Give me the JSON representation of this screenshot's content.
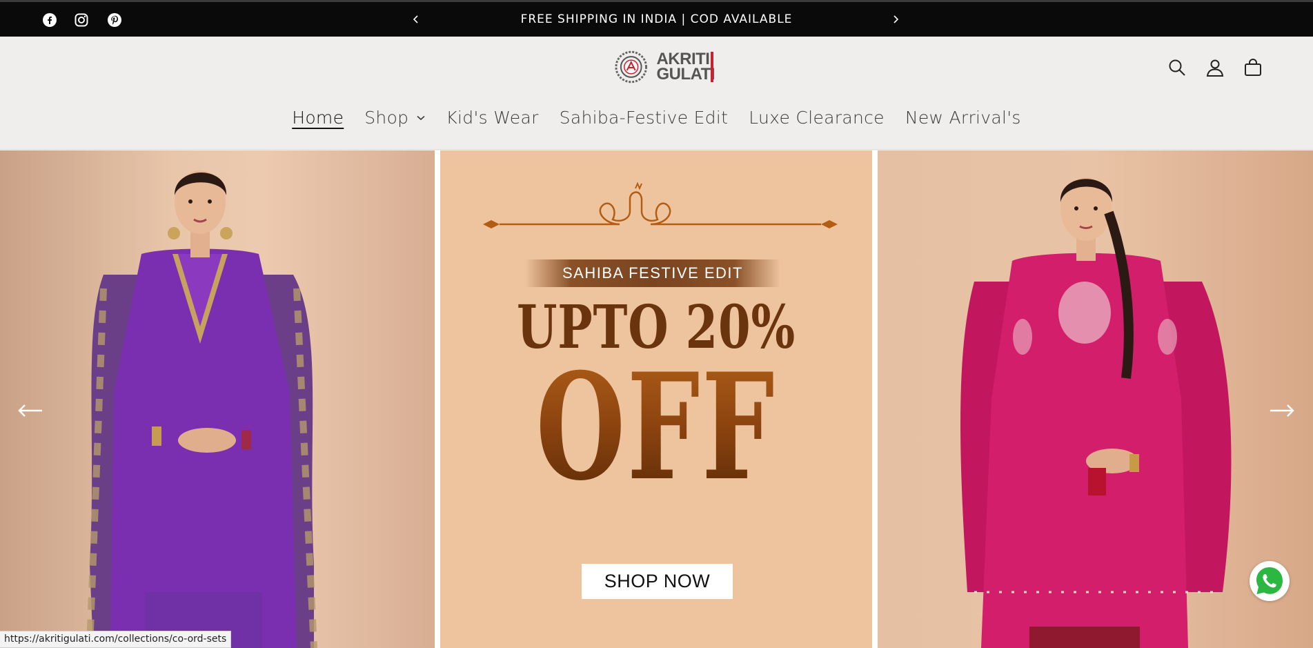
{
  "announcement": {
    "text": "FREE SHIPPING IN INDIA | COD AVAILABLE",
    "social": [
      "facebook-icon",
      "instagram-icon",
      "pinterest-icon"
    ]
  },
  "header": {
    "logo_line1": "AKRITI",
    "logo_line2": "GULATI",
    "icons": [
      "search-icon",
      "account-icon",
      "cart-icon"
    ]
  },
  "nav": {
    "items": [
      {
        "label": "Home",
        "active": true
      },
      {
        "label": "Shop",
        "dropdown": true
      },
      {
        "label": "Kid's Wear"
      },
      {
        "label": "Sahiba-Festive Edit"
      },
      {
        "label": "Luxe Clearance"
      },
      {
        "label": "New Arrival's"
      }
    ]
  },
  "hero": {
    "banner_tag": "SAHIBA FESTIVE EDIT",
    "headline": "UPTO 20%",
    "offer": "OFF",
    "cta": "SHOP NOW"
  },
  "status_url": "https://akritigulati.com/collections/co-ord-sets",
  "colors": {
    "announce_bg": "#0a0a0a",
    "header_bg": "#efeeec",
    "banner_bg": "#eec49e",
    "accent_brown": "#6a340f",
    "logo_red": "#cc1f2f"
  }
}
